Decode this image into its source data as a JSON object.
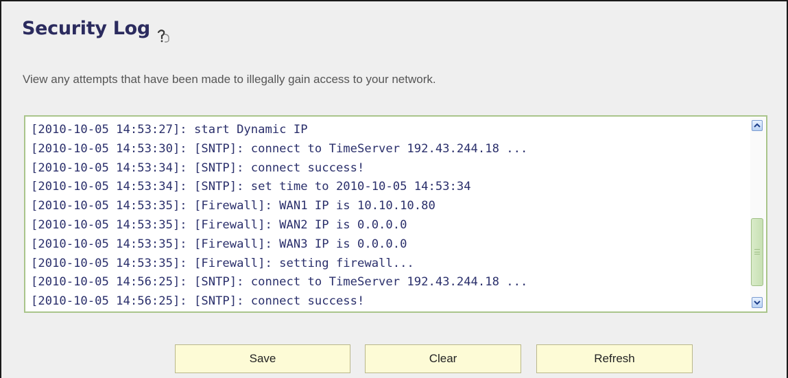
{
  "header": {
    "title": "Security Log",
    "help_icon": "help-question-icon"
  },
  "description": "View any attempts that have been made to illegally gain access to your network.",
  "log": {
    "lines": [
      "[2010-10-05 14:53:27]: start Dynamic IP",
      "[2010-10-05 14:53:30]: [SNTP]: connect to TimeServer 192.43.244.18 ...",
      "[2010-10-05 14:53:34]: [SNTP]: connect success!",
      "[2010-10-05 14:53:34]: [SNTP]: set time to 2010-10-05 14:53:34",
      "[2010-10-05 14:53:35]: [Firewall]: WAN1 IP is 10.10.10.80",
      "[2010-10-05 14:53:35]: [Firewall]: WAN2 IP is 0.0.0.0",
      "[2010-10-05 14:53:35]: [Firewall]: WAN3 IP is 0.0.0.0",
      "[2010-10-05 14:53:35]: [Firewall]: setting firewall...",
      "[2010-10-05 14:56:25]: [SNTP]: connect to TimeServer 192.43.244.18 ...",
      "[2010-10-05 14:56:25]: [SNTP]: connect success!"
    ],
    "scroll": {
      "thumb_start_fraction": 0.52,
      "thumb_end_fraction": 0.87
    }
  },
  "buttons": {
    "save_label": "Save",
    "clear_label": "Clear",
    "refresh_label": "Refresh"
  },
  "colors": {
    "title": "#2b2b5e",
    "log_text": "#2a2f6b",
    "log_border": "#a9c48a",
    "button_bg": "#fdfbd6"
  }
}
